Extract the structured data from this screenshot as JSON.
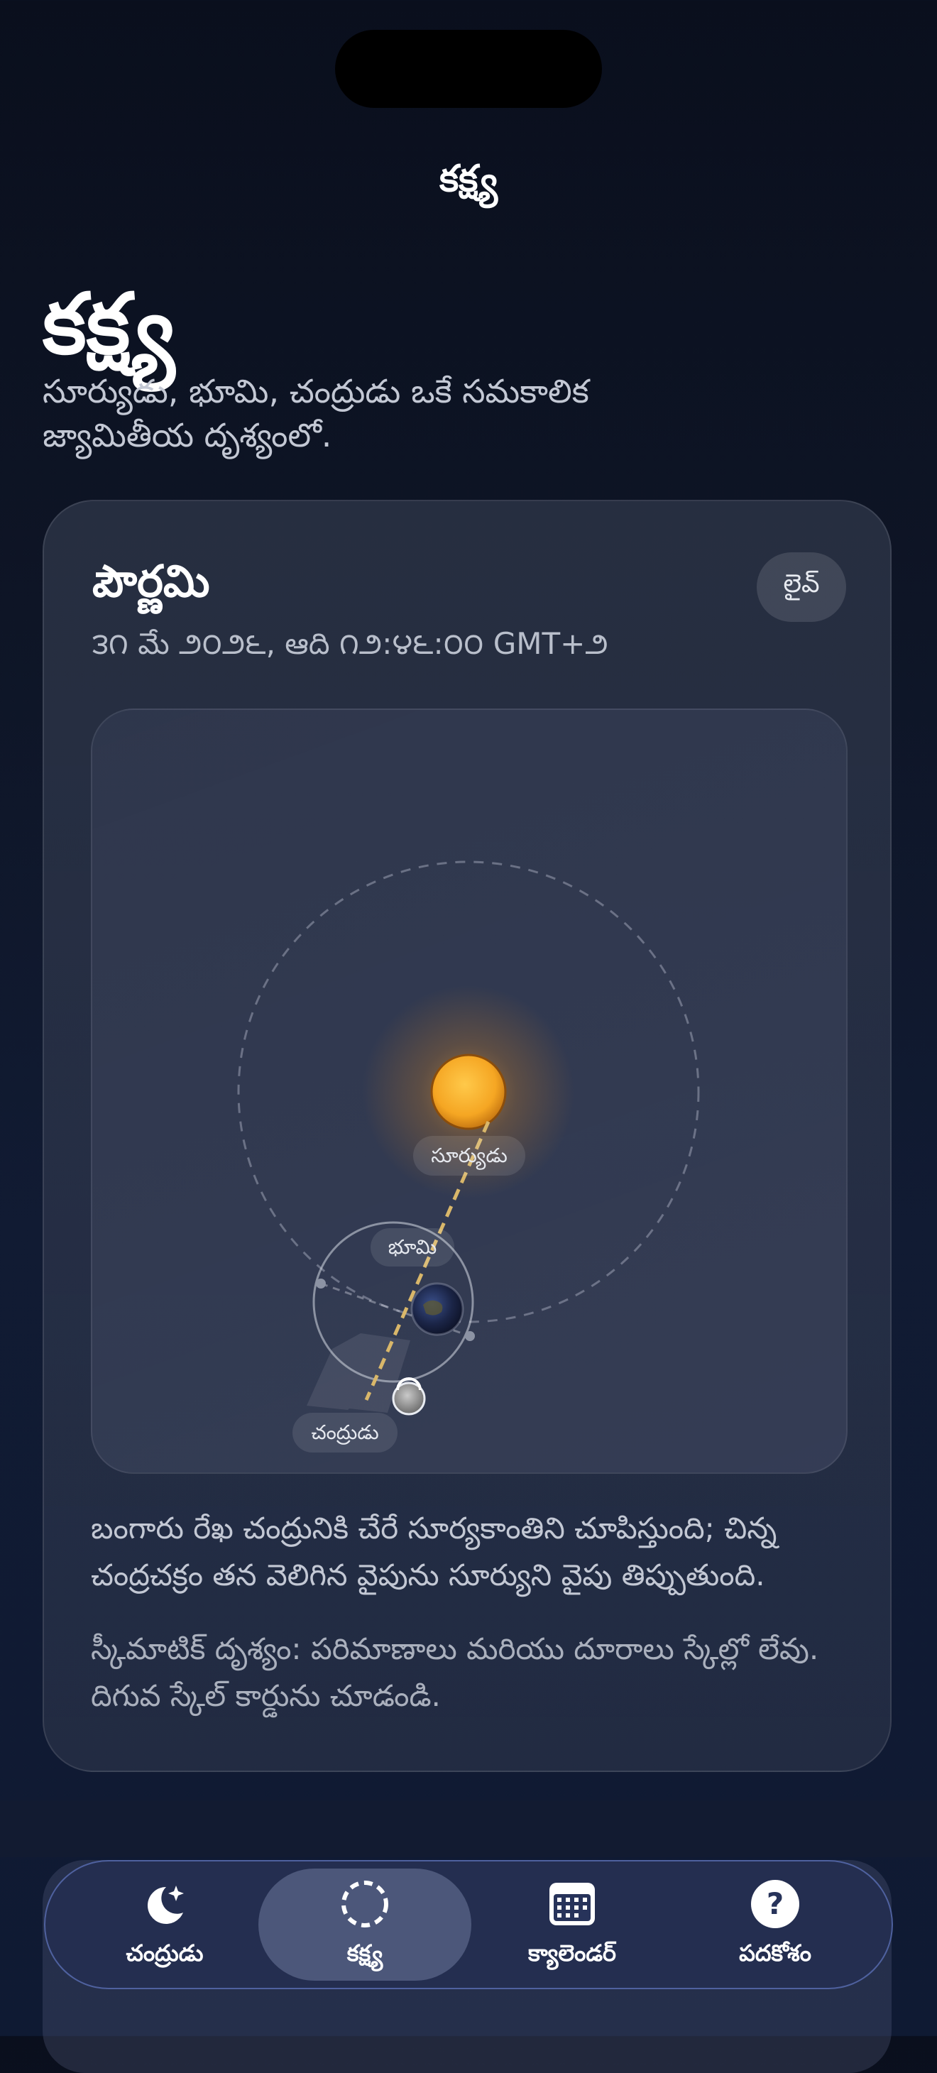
{
  "header": {
    "nav_title": "కక్ష్య",
    "large_title": "కక్ష్య",
    "subtitle": "సూర్యుడు, భూమి, చంద్రుడు ఒకే సమకాలిక జ్యామితీయ దృశ్యంలో."
  },
  "card": {
    "phase_name": "పౌర్ణమి",
    "date_line": "౩౧ మే ౨౦౨౬, ఆది ౧౨:౪౬:౦౦ GMT+౨",
    "live_label": "లైవ్",
    "diagram": {
      "sun_label": "సూర్యుడు",
      "earth_label": "భూమి",
      "moon_label": "చంద్రుడు"
    },
    "description": "బంగారు రేఖ చంద్రునికి చేరే సూర్యకాంతిని చూపిస్తుంది; చిన్న చంద్రచక్రం తన వెలిగిన వైపును సూర్యుని వైపు తిప్పుతుంది.",
    "note": "స్కీమాటిక్ దృశ్యం: పరిమాణాలు మరియు దూరాలు స్కేల్లో లేవు. దిగువ స్కేల్ కార్డును చూడండి."
  },
  "tabs": [
    {
      "label": "చంద్రుడు",
      "icon": "moon-stars-icon",
      "active": false
    },
    {
      "label": "కక్ష్య",
      "icon": "orbit-dashed-circle-icon",
      "active": true
    },
    {
      "label": "క్యాలెండర్",
      "icon": "calendar-icon",
      "active": false
    },
    {
      "label": "పదకోశం",
      "icon": "question-circle-icon",
      "active": false
    }
  ],
  "colors": {
    "accent_sun": "#f5a623",
    "sunlight_line": "#d9b76a",
    "tab_border": "#7f9cff"
  }
}
